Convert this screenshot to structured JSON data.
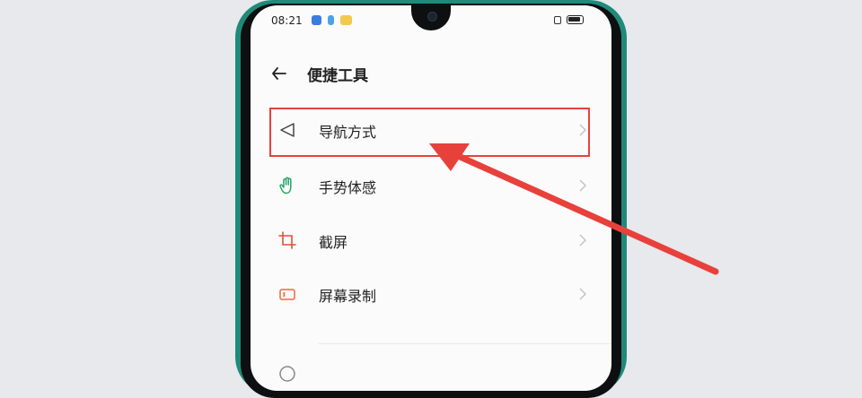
{
  "status_bar": {
    "time": "08:21"
  },
  "header": {
    "title": "便捷工具"
  },
  "menu": {
    "items": [
      {
        "label": "导航方式",
        "icon": "navigation-triangle-icon"
      },
      {
        "label": "手势体感",
        "icon": "hand-gesture-icon"
      },
      {
        "label": "截屏",
        "icon": "crop-icon"
      },
      {
        "label": "屏幕录制",
        "icon": "screen-record-icon"
      }
    ]
  },
  "colors": {
    "phone_frame": "#1f8a7a",
    "accent": "#e8413c",
    "annotation": "#e8413c"
  }
}
